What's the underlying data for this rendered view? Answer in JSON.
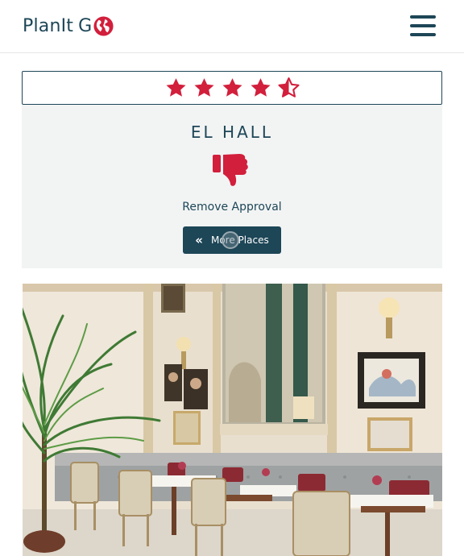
{
  "header": {
    "logo_main": "PlanIt",
    "logo_suffix": "G",
    "logo_icon": "globe-o-icon",
    "menu_icon": "hamburger-menu-icon"
  },
  "rating": {
    "value": 4.5,
    "max": 5,
    "star_color": "#d21f3c"
  },
  "place": {
    "name": "EL HALL",
    "approval_icon": "thumbs-down-icon",
    "remove_label": "Remove Approval",
    "more_button_label": "More Places",
    "more_button_icon": "double-chevron-left-icon"
  },
  "photo": {
    "subject": "restaurant-interior-photo"
  },
  "colors": {
    "primary": "#1d4657",
    "accent": "#d21f3c",
    "card_bg": "#f2f4f4"
  }
}
